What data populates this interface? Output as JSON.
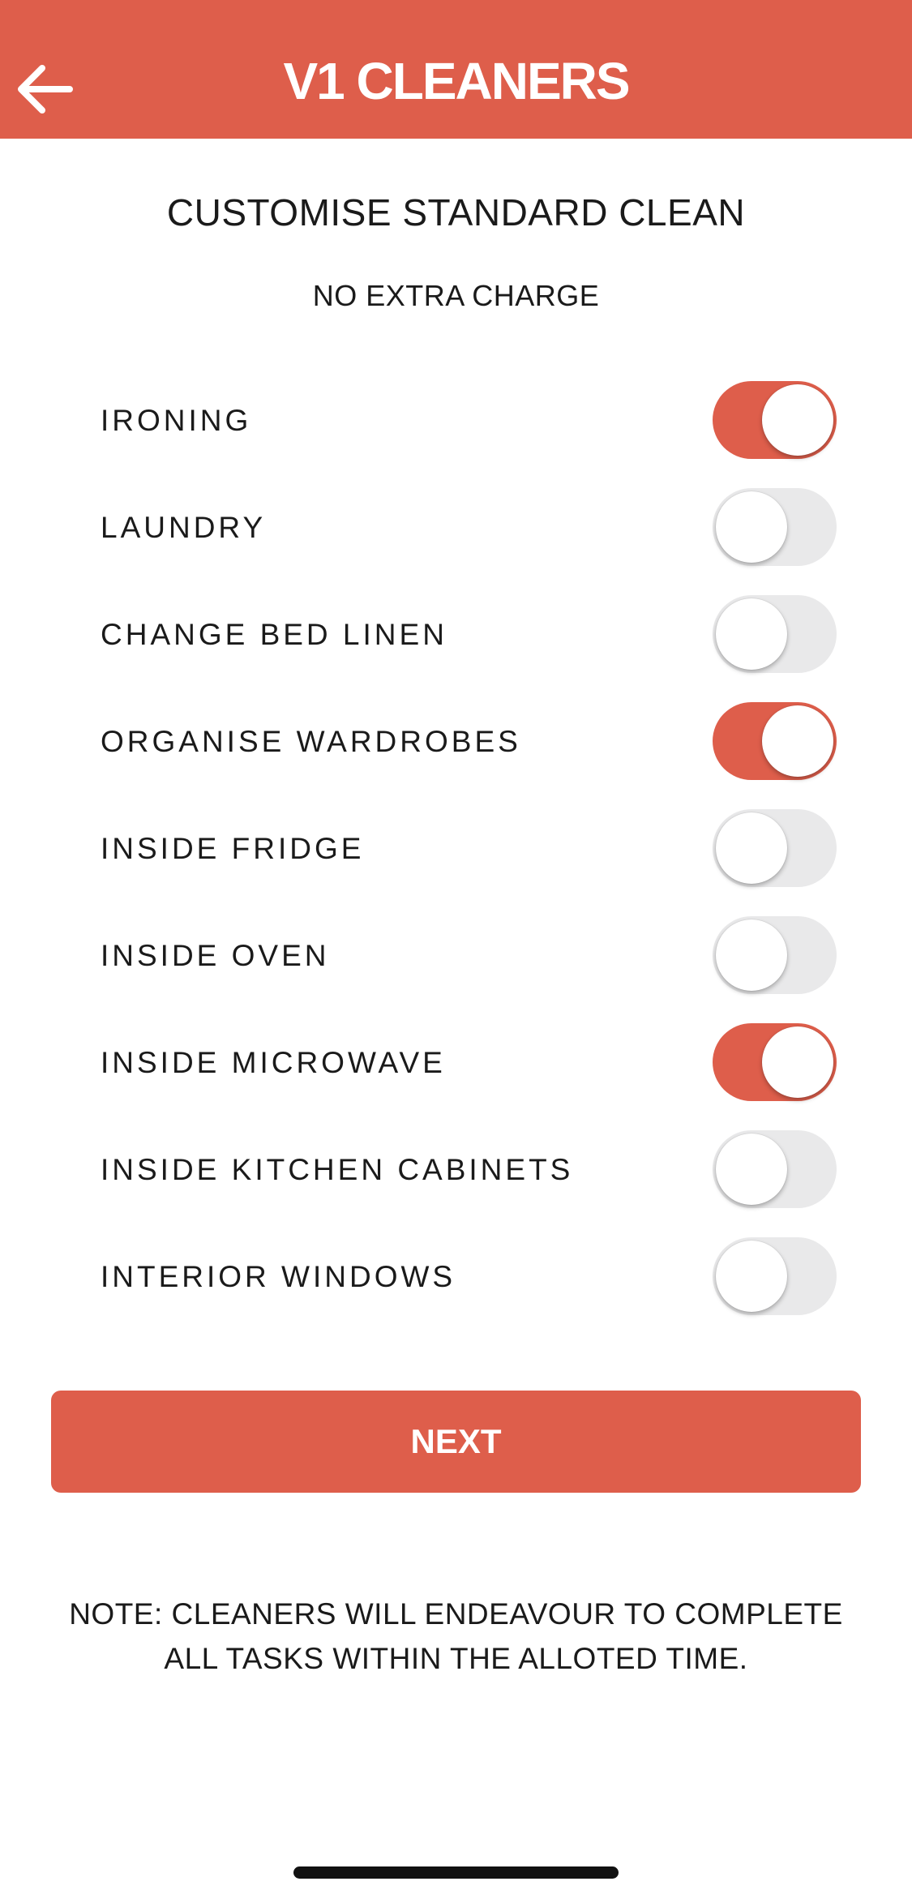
{
  "header": {
    "title": "V1 CLEANERS",
    "back_icon": "arrow-left-icon",
    "background_color": "#DE5E4B"
  },
  "page": {
    "title": "CUSTOMISE STANDARD CLEAN",
    "subtitle": "NO EXTRA CHARGE"
  },
  "options": [
    {
      "label": "IRONING",
      "enabled": true
    },
    {
      "label": "LAUNDRY",
      "enabled": false
    },
    {
      "label": "CHANGE BED LINEN",
      "enabled": false
    },
    {
      "label": "ORGANISE WARDROBES",
      "enabled": true
    },
    {
      "label": "INSIDE FRIDGE",
      "enabled": false
    },
    {
      "label": "INSIDE OVEN",
      "enabled": false
    },
    {
      "label": "INSIDE MICROWAVE",
      "enabled": true
    },
    {
      "label": "INSIDE KITCHEN CABINETS",
      "enabled": false
    },
    {
      "label": "INTERIOR WINDOWS",
      "enabled": false
    }
  ],
  "next_button": {
    "label": "NEXT"
  },
  "note": {
    "line1": "NOTE: CLEANERS WILL ENDEAVOUR TO COMPLETE",
    "line2": "ALL TASKS WITHIN THE ALLOTED TIME."
  },
  "colors": {
    "accent": "#DE5E4B",
    "toggle_off": "#E9E9EA",
    "text": "#1A1A1A"
  }
}
